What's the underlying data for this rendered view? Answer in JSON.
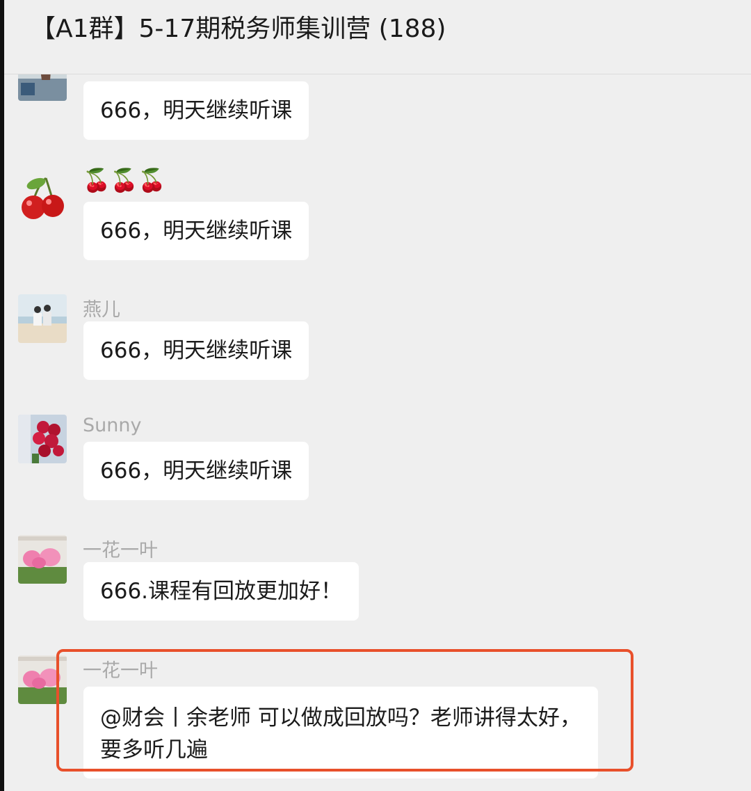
{
  "header": {
    "title": "【A1群】5-17期税务师集训营 (188)"
  },
  "messages": [
    {
      "sender": "",
      "avatar": "photo-avatar-icon",
      "text": "666，明天继续听课"
    },
    {
      "sender": "🍒🍒🍒",
      "avatar": "cherry-avatar-icon",
      "text": "666，明天继续听课"
    },
    {
      "sender": "燕儿",
      "avatar": "beach-couple-avatar-icon",
      "text": "666，明天继续听课"
    },
    {
      "sender": "Sunny",
      "avatar": "roses-avatar-icon",
      "text": "666，明天继续听课"
    },
    {
      "sender": "一花一叶",
      "avatar": "lotus-avatar-icon",
      "text": "666.课程有回放更加好！"
    },
    {
      "sender": "一花一叶",
      "avatar": "lotus-avatar-icon",
      "text_line1": "@财会丨余老师 可以做成回放吗？老师讲得太好，",
      "text_line2": "要多听几遍"
    }
  ],
  "colors": {
    "background": "#efefef",
    "bubble": "#ffffff",
    "sender_name": "#a9a9a9",
    "highlight_border": "#e8502b"
  }
}
